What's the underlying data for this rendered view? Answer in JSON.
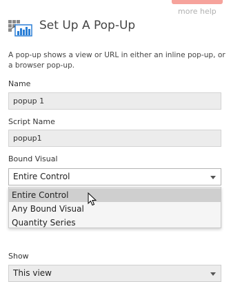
{
  "header": {
    "more_help": "more help",
    "title": "Set Up A Pop-Up",
    "icon": "popup-chart-icon"
  },
  "description": "A pop-up shows a view or URL in either an inline pop-up, or a browser pop-up.",
  "fields": {
    "name": {
      "label": "Name",
      "value": "popup 1"
    },
    "script_name": {
      "label": "Script Name",
      "value": "popup1"
    },
    "bound_visual": {
      "label": "Bound Visual",
      "selected": "Entire Control",
      "options": [
        "Entire Control",
        "Any Bound Visual",
        "Quantity Series"
      ],
      "hovered_option": "Entire Control"
    },
    "show": {
      "label": "Show",
      "selected": "This view"
    }
  },
  "colors": {
    "accent_button": "#f6a39c",
    "field_background": "#ececec",
    "dropdown_hover": "#cfcfcf"
  }
}
